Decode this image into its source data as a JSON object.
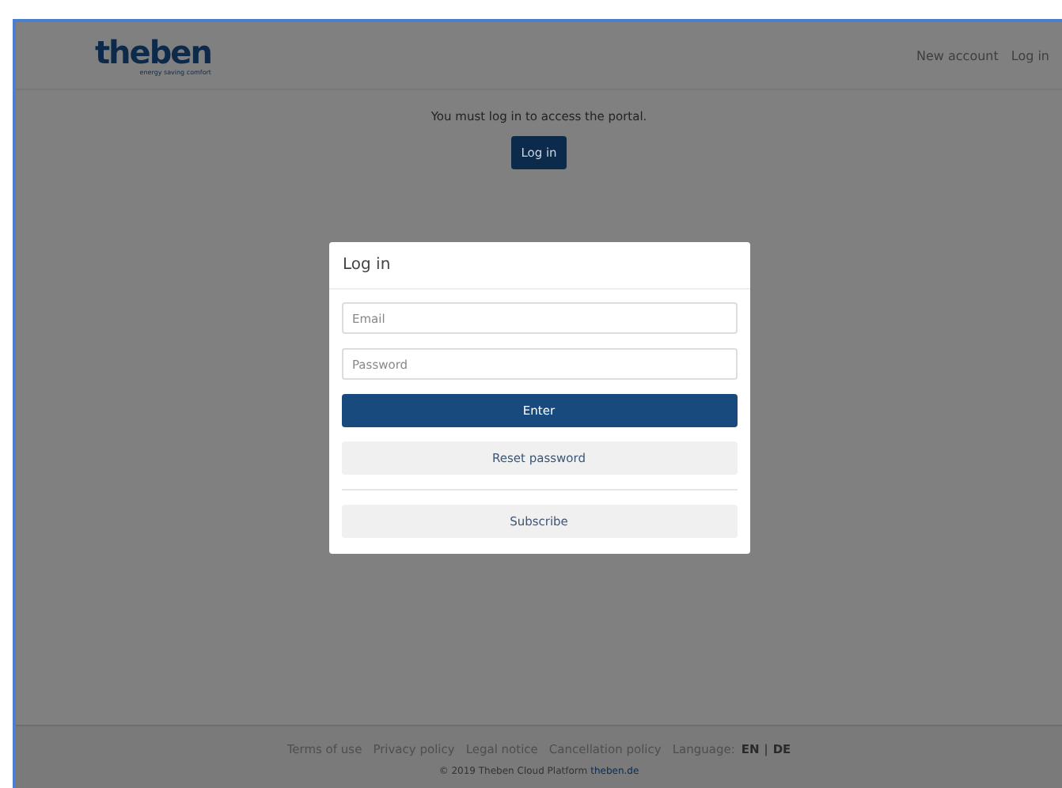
{
  "header": {
    "logo": "theben",
    "tagline": "energy saving comfort",
    "nav": [
      "New account",
      "Log in"
    ]
  },
  "notice": {
    "message": "You must log in to access the portal.",
    "button": "Log in"
  },
  "dialog": {
    "title": "Log in",
    "fields": [
      {
        "placeholder": "Email"
      },
      {
        "placeholder": "Password"
      }
    ],
    "primary_button": "Enter",
    "secondary_button": "Reset password",
    "subscribe_button": "Subscribe"
  },
  "footer": {
    "links": [
      "Terms of use",
      "Privacy policy",
      "Legal notice",
      "Cancellation policy"
    ],
    "language_label": "Language:",
    "languages": [
      "EN",
      "DE"
    ],
    "separator": "|",
    "copyright": "© 2019 Theben Cloud Platform",
    "site_link": "theben.de"
  }
}
